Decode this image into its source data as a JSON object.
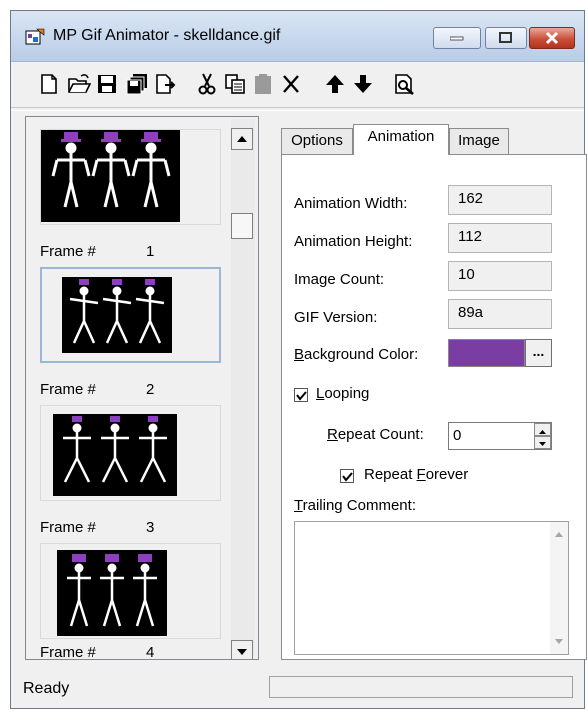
{
  "window": {
    "title": "MP Gif Animator - skelldance.gif"
  },
  "toolbar": {
    "buttons": [
      {
        "name": "new-icon"
      },
      {
        "name": "open-icon"
      },
      {
        "name": "save-icon"
      },
      {
        "name": "save-all-icon"
      },
      {
        "name": "export-icon"
      },
      {
        "name": "cut-icon"
      },
      {
        "name": "copy-icon"
      },
      {
        "name": "paste-icon"
      },
      {
        "name": "delete-icon"
      },
      {
        "name": "move-up-icon"
      },
      {
        "name": "move-down-icon"
      },
      {
        "name": "preview-icon"
      }
    ]
  },
  "frames": {
    "label": "Frame #",
    "items": [
      {
        "number": "1"
      },
      {
        "number": "2"
      },
      {
        "number": "3"
      },
      {
        "number": "4"
      }
    ]
  },
  "tabs": [
    {
      "label": "Options"
    },
    {
      "label": "Animation"
    },
    {
      "label": "Image"
    }
  ],
  "animation": {
    "width_label": "Animation Width:",
    "width_value": "162",
    "height_label": "Animation Height:",
    "height_value": "112",
    "count_label": "Image Count:",
    "count_value": "10",
    "version_label": "GIF Version:",
    "version_value": "89a",
    "bg_label_first": "B",
    "bg_label_rest": "ackground Color:",
    "bg_color": "#7a3ea3",
    "bg_button": "...",
    "looping_first": "L",
    "looping_rest": "ooping",
    "looping_checked": true,
    "repeat_count_first": "R",
    "repeat_count_rest": "epeat Count:",
    "repeat_count_value": "0",
    "repeat_forever_pre": "Repeat ",
    "repeat_forever_first": "F",
    "repeat_forever_rest": "orever",
    "repeat_forever_checked": true,
    "comment_first": "T",
    "comment_rest": "railing Comment:",
    "comment_value": ""
  },
  "status": {
    "text": "Ready"
  }
}
